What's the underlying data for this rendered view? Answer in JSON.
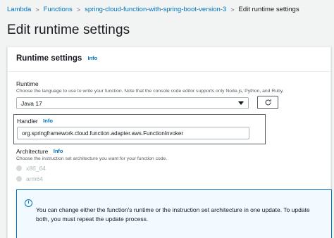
{
  "breadcrumb": {
    "items": [
      "Lambda",
      "Functions",
      "spring-cloud-function-with-spring-boot-version-3"
    ],
    "current": "Edit runtime settings"
  },
  "page": {
    "title": "Edit runtime settings"
  },
  "runtime_settings": {
    "title": "Runtime settings",
    "info_label": "Info",
    "runtime": {
      "label": "Runtime",
      "description": "Choose the language to use to write your function. Note that the console code editor supports only Node.js, Python, and Ruby.",
      "selected": "Java 17"
    },
    "handler": {
      "label": "Handler",
      "info_label": "Info",
      "value": "org.springframework.cloud.function.adapter.aws.FunctionInvoker"
    },
    "architecture": {
      "label": "Architecture",
      "info_label": "Info",
      "description": "Choose the instruction set architecture you want for your function code.",
      "options": [
        "x86_64",
        "arm64"
      ]
    },
    "alert": {
      "text": "You can change either the function's runtime or the instruction set architecture in one update. To update both, you must repeat the update process."
    }
  },
  "icons": {
    "refresh": "refresh-icon",
    "info": "info-circle-icon",
    "dropdown": "caret-down-icon"
  },
  "colors": {
    "link": "#0073bb",
    "background": "#f2f3f3",
    "alert_bg": "#f1faff",
    "alert_border": "#0073bb"
  }
}
